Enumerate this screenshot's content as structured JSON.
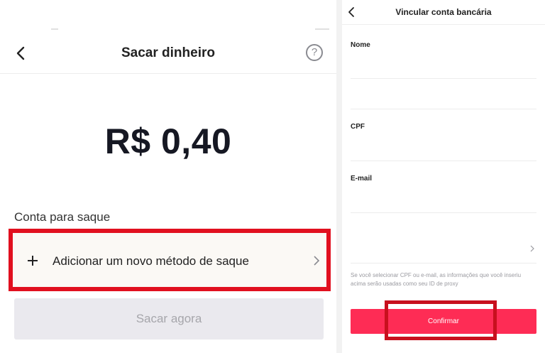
{
  "left": {
    "title": "Sacar dinheiro",
    "help_glyph": "?",
    "balance": "R$ 0,40",
    "section_label": "Conta para saque",
    "add_method_label": "Adicionar um novo método de saque",
    "withdraw_button": "Sacar agora"
  },
  "right": {
    "title": "Vincular conta bancária",
    "fields": [
      {
        "label": "Nome",
        "value": ""
      },
      {
        "label": "CPF",
        "value": ""
      },
      {
        "label": "E-mail",
        "value": ""
      }
    ],
    "note": "Se você selecionar CPF ou e-mail, as informações que você inseriu acima serão usadas como seu ID de proxy",
    "confirm_button": "Confirmar"
  },
  "colors": {
    "highlight_red": "#e1101f",
    "confirm_pink": "#fe2c55",
    "disabled_gray": "#eae9ee"
  },
  "icons": [
    "back-arrow-icon",
    "help-icon",
    "plus-icon",
    "chevron-right-icon"
  ]
}
